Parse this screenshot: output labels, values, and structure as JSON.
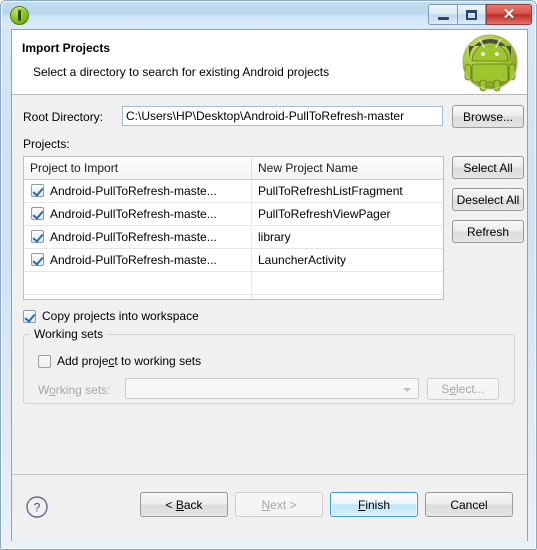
{
  "window": {
    "title": "",
    "app_icon": "eclipse-icon",
    "controls": {
      "minimize": "minimize-icon",
      "maximize": "maximize-icon",
      "close": "✕"
    }
  },
  "wizard": {
    "title": "Import Projects",
    "subtitle": "Select a directory to search for existing Android projects",
    "banner_icon": "android-robot-icon"
  },
  "form": {
    "root_directory_label": "Root Directory:",
    "root_directory_value": "C:\\Users\\HP\\Desktop\\Android-PullToRefresh-master",
    "root_directory_placeholder": "",
    "browse_label": "Browse...",
    "projects_label": "Projects:"
  },
  "table": {
    "columns": [
      "Project to Import",
      "New Project Name"
    ],
    "rows": [
      {
        "checked": true,
        "project": "Android-PullToRefresh-maste...",
        "new_name": "PullToRefreshListFragment"
      },
      {
        "checked": true,
        "project": "Android-PullToRefresh-maste...",
        "new_name": "PullToRefreshViewPager"
      },
      {
        "checked": true,
        "project": "Android-PullToRefresh-maste...",
        "new_name": "library"
      },
      {
        "checked": true,
        "project": "Android-PullToRefresh-maste...",
        "new_name": "LauncherActivity"
      },
      {
        "checked": null,
        "project": "",
        "new_name": ""
      },
      {
        "checked": null,
        "project": "",
        "new_name": ""
      }
    ]
  },
  "side_buttons": {
    "select_all": "Select All",
    "deselect_all": "Deselect All",
    "refresh": "Refresh"
  },
  "options": {
    "copy_projects_label": "Copy projects into workspace",
    "copy_projects_checked": true
  },
  "working_sets": {
    "group_title": "Working sets",
    "add_label": "Add project to working sets",
    "add_checked": false,
    "combo_label": "Working sets:",
    "combo_value": "",
    "select_label": "Select..."
  },
  "footer": {
    "help": "?",
    "back": "< Back",
    "next": "Next >",
    "finish": "Finish",
    "cancel": "Cancel"
  },
  "colors": {
    "accent": "#3c9bd6",
    "android_green": "#a4c639",
    "dialog_bg": "#f0f0f0",
    "close_red": "#bd2c26"
  }
}
